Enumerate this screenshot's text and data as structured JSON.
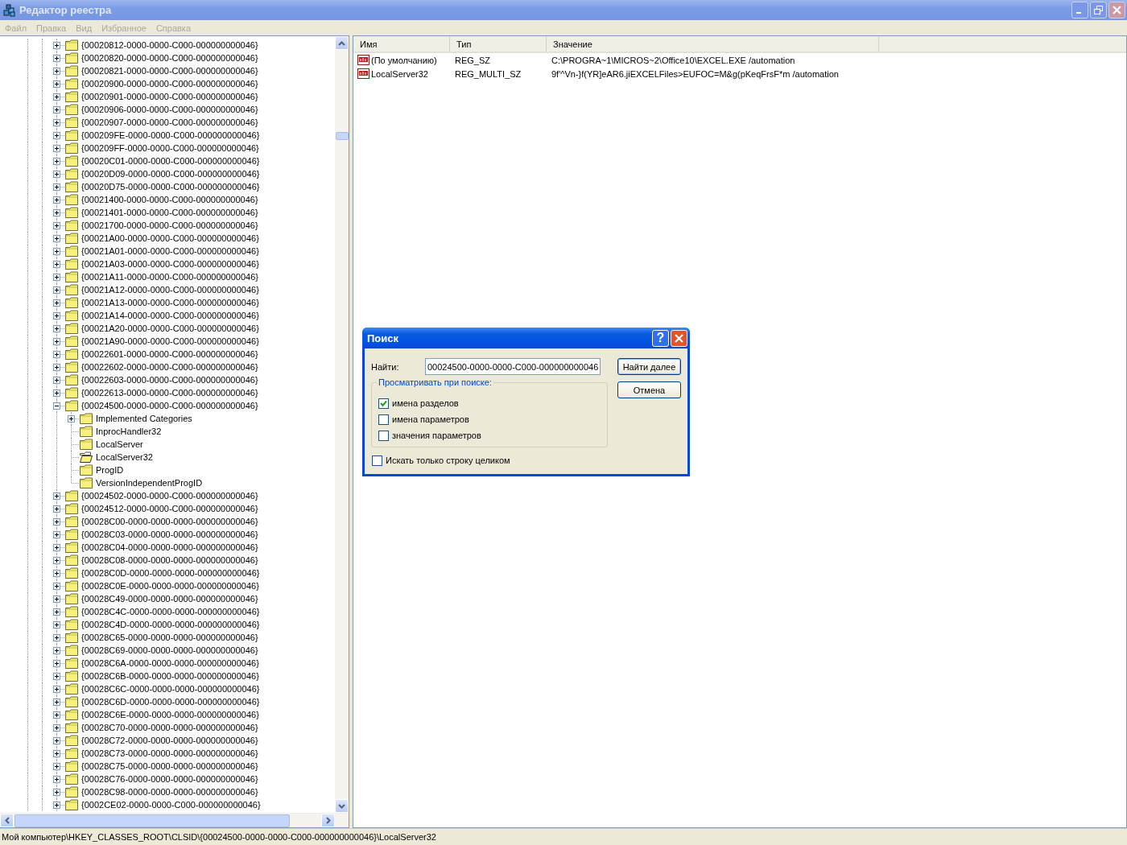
{
  "window": {
    "title": "Редактор реестра"
  },
  "menu": [
    {
      "label": "Файл",
      "disabled": true
    },
    {
      "label": "Правка",
      "disabled": true
    },
    {
      "label": "Вид",
      "disabled": true
    },
    {
      "label": "Избранное",
      "disabled": true
    },
    {
      "label": "Справка",
      "disabled": true
    }
  ],
  "tree": [
    {
      "label": "{00020812-0000-0000-C000-000000000046}",
      "expanded": false
    },
    {
      "label": "{00020820-0000-0000-C000-000000000046}",
      "expanded": false
    },
    {
      "label": "{00020821-0000-0000-C000-000000000046}",
      "expanded": false
    },
    {
      "label": "{00020900-0000-0000-C000-000000000046}",
      "expanded": false
    },
    {
      "label": "{00020901-0000-0000-C000-000000000046}",
      "expanded": false
    },
    {
      "label": "{00020906-0000-0000-C000-000000000046}",
      "expanded": false
    },
    {
      "label": "{00020907-0000-0000-C000-000000000046}",
      "expanded": false
    },
    {
      "label": "{000209FE-0000-0000-C000-000000000046}",
      "expanded": false
    },
    {
      "label": "{000209FF-0000-0000-C000-000000000046}",
      "expanded": false
    },
    {
      "label": "{00020C01-0000-0000-C000-000000000046}",
      "expanded": false
    },
    {
      "label": "{00020D09-0000-0000-C000-000000000046}",
      "expanded": false
    },
    {
      "label": "{00020D75-0000-0000-C000-000000000046}",
      "expanded": false
    },
    {
      "label": "{00021400-0000-0000-C000-000000000046}",
      "expanded": false
    },
    {
      "label": "{00021401-0000-0000-C000-000000000046}",
      "expanded": false
    },
    {
      "label": "{00021700-0000-0000-C000-000000000046}",
      "expanded": false
    },
    {
      "label": "{00021A00-0000-0000-C000-000000000046}",
      "expanded": false
    },
    {
      "label": "{00021A01-0000-0000-C000-000000000046}",
      "expanded": false
    },
    {
      "label": "{00021A03-0000-0000-C000-000000000046}",
      "expanded": false
    },
    {
      "label": "{00021A11-0000-0000-C000-000000000046}",
      "expanded": false
    },
    {
      "label": "{00021A12-0000-0000-C000-000000000046}",
      "expanded": false
    },
    {
      "label": "{00021A13-0000-0000-C000-000000000046}",
      "expanded": false
    },
    {
      "label": "{00021A14-0000-0000-C000-000000000046}",
      "expanded": false
    },
    {
      "label": "{00021A20-0000-0000-C000-000000000046}",
      "expanded": false
    },
    {
      "label": "{00021A90-0000-0000-C000-000000000046}",
      "expanded": false
    },
    {
      "label": "{00022601-0000-0000-C000-000000000046}",
      "expanded": false
    },
    {
      "label": "{00022602-0000-0000-C000-000000000046}",
      "expanded": false
    },
    {
      "label": "{00022603-0000-0000-C000-000000000046}",
      "expanded": false
    },
    {
      "label": "{00022613-0000-0000-C000-000000000046}",
      "expanded": false
    },
    {
      "label": "{00024500-0000-0000-C000-000000000046}",
      "expanded": true,
      "children": [
        {
          "label": "Implemented Categories",
          "kind": "branch",
          "selected": false
        },
        {
          "label": "InprocHandler32",
          "kind": "leaf",
          "selected": false
        },
        {
          "label": "LocalServer",
          "kind": "leaf",
          "selected": false
        },
        {
          "label": "LocalServer32",
          "kind": "leaf",
          "selected": true
        },
        {
          "label": "ProgID",
          "kind": "leaf",
          "selected": false
        },
        {
          "label": "VersionIndependentProgID",
          "kind": "leaf",
          "selected": false
        }
      ]
    },
    {
      "label": "{00024502-0000-0000-C000-000000000046}",
      "expanded": false
    },
    {
      "label": "{00024512-0000-0000-C000-000000000046}",
      "expanded": false
    },
    {
      "label": "{00028C00-0000-0000-0000-000000000046}",
      "expanded": false
    },
    {
      "label": "{00028C03-0000-0000-0000-000000000046}",
      "expanded": false
    },
    {
      "label": "{00028C04-0000-0000-0000-000000000046}",
      "expanded": false
    },
    {
      "label": "{00028C08-0000-0000-0000-000000000046}",
      "expanded": false
    },
    {
      "label": "{00028C0D-0000-0000-0000-000000000046}",
      "expanded": false
    },
    {
      "label": "{00028C0E-0000-0000-0000-000000000046}",
      "expanded": false
    },
    {
      "label": "{00028C49-0000-0000-0000-000000000046}",
      "expanded": false
    },
    {
      "label": "{00028C4C-0000-0000-0000-000000000046}",
      "expanded": false
    },
    {
      "label": "{00028C4D-0000-0000-0000-000000000046}",
      "expanded": false
    },
    {
      "label": "{00028C65-0000-0000-0000-000000000046}",
      "expanded": false
    },
    {
      "label": "{00028C69-0000-0000-0000-000000000046}",
      "expanded": false
    },
    {
      "label": "{00028C6A-0000-0000-0000-000000000046}",
      "expanded": false
    },
    {
      "label": "{00028C6B-0000-0000-0000-000000000046}",
      "expanded": false
    },
    {
      "label": "{00028C6C-0000-0000-0000-000000000046}",
      "expanded": false
    },
    {
      "label": "{00028C6D-0000-0000-0000-000000000046}",
      "expanded": false
    },
    {
      "label": "{00028C6E-0000-0000-0000-000000000046}",
      "expanded": false
    },
    {
      "label": "{00028C70-0000-0000-0000-000000000046}",
      "expanded": false
    },
    {
      "label": "{00028C72-0000-0000-0000-000000000046}",
      "expanded": false
    },
    {
      "label": "{00028C73-0000-0000-0000-000000000046}",
      "expanded": false
    },
    {
      "label": "{00028C75-0000-0000-0000-000000000046}",
      "expanded": false
    },
    {
      "label": "{00028C76-0000-0000-0000-000000000046}",
      "expanded": false
    },
    {
      "label": "{00028C98-0000-0000-0000-000000000046}",
      "expanded": false
    },
    {
      "label": "{0002CE02-0000-0000-C000-000000000046}",
      "expanded": false
    }
  ],
  "values": {
    "columns": [
      "Имя",
      "Тип",
      "Значение"
    ],
    "rows": [
      {
        "name": "(По умолчанию)",
        "type": "REG_SZ",
        "data": "C:\\PROGRA~1\\MICROS~2\\Office10\\EXCEL.EXE /automation"
      },
      {
        "name": "LocalServer32",
        "type": "REG_MULTI_SZ",
        "data": "9f'^Vn-}f(YR]eAR6.jiEXCELFiles>EUFOC=M&g(pKeqFrsF*m /automation"
      }
    ]
  },
  "status_bar": "Мой компьютер\\HKEY_CLASSES_ROOT\\CLSID\\{00024500-0000-0000-C000-000000000046}\\LocalServer32",
  "dialog": {
    "title": "Поиск",
    "help_button": "?",
    "find_label": "Найти:",
    "find_value": "00024500-0000-0000-C000-000000000046",
    "group_title": "Просматривать при поиске:",
    "options": [
      {
        "label": "имена разделов",
        "checked": true
      },
      {
        "label": "имена параметров",
        "checked": false
      },
      {
        "label": "значения параметров",
        "checked": false
      }
    ],
    "whole_string": {
      "label": "Искать только строку целиком",
      "checked": false
    },
    "buttons": [
      "Найти далее",
      "Отмена"
    ]
  }
}
